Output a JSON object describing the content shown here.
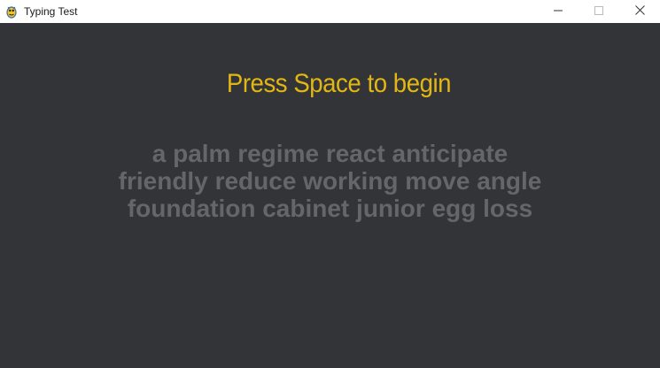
{
  "window": {
    "title": "Typing Test",
    "app_icon": "pygame-snake-icon",
    "controls": {
      "minimize_icon": "minimize-icon",
      "maximize_icon": "maximize-icon",
      "close_icon": "close-icon"
    }
  },
  "game": {
    "prompt": "Press Space to begin",
    "word_lines": [
      "a palm regime react anticipate",
      "friendly reduce working move angle",
      "foundation cabinet junior egg loss"
    ]
  },
  "colors": {
    "background": "#323437",
    "prompt": "#e2b714",
    "words_untyped": "#646669"
  }
}
